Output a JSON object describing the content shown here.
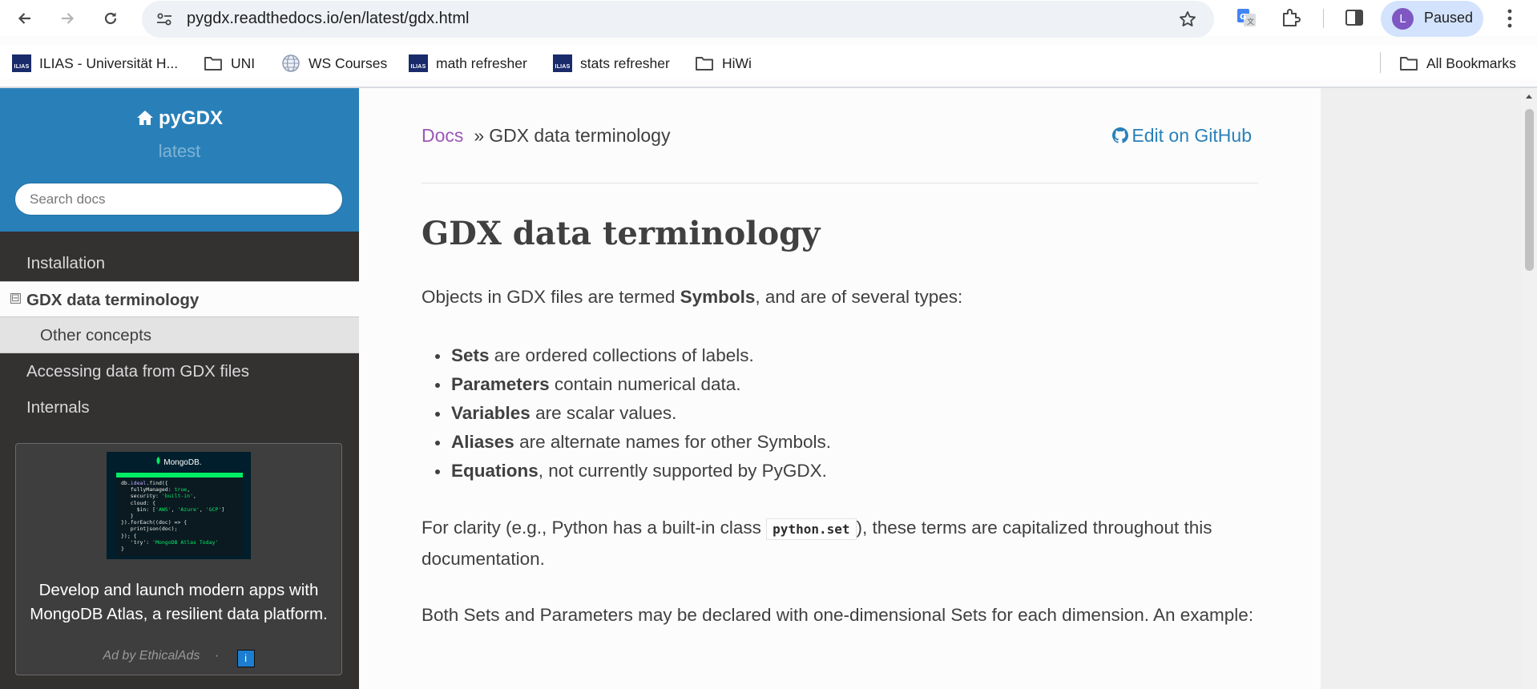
{
  "browser": {
    "url": "pygdx.readthedocs.io/en/latest/gdx.html",
    "profile_initial": "L",
    "profile_status": "Paused",
    "bookmarks": [
      {
        "label": "ILIAS - Universität H...",
        "icon": "ilias-icon"
      },
      {
        "label": "UNI",
        "icon": "folder-icon"
      },
      {
        "label": "WS Courses",
        "icon": "globe-icon"
      },
      {
        "label": "math refresher",
        "icon": "ilias-icon"
      },
      {
        "label": "stats refresher",
        "icon": "ilias-icon"
      },
      {
        "label": "HiWi",
        "icon": "folder-icon"
      }
    ],
    "all_bookmarks": "All Bookmarks"
  },
  "sidebar": {
    "project": "pyGDX",
    "version": "latest",
    "search_placeholder": "Search docs",
    "items": [
      {
        "label": "Installation"
      },
      {
        "label": "GDX data terminology",
        "toggle": "⊟"
      },
      {
        "label": "Other concepts"
      },
      {
        "label": "Accessing data from GDX files"
      },
      {
        "label": "Internals"
      }
    ],
    "ad": {
      "logo": "MongoDB.",
      "text": "Develop and launch modern apps with MongoDB Atlas, a resilient data platform.",
      "by": "Ad by EthicalAds",
      "dot": "·",
      "info": "i"
    }
  },
  "content": {
    "breadcrumb_root": "Docs",
    "breadcrumb_sep": "»",
    "breadcrumb_current": "GDX data terminology",
    "edit_link": "Edit on GitHub",
    "title": "GDX data terminology",
    "intro_pre": "Objects in GDX files are termed ",
    "intro_bold": "Symbols",
    "intro_post": ", and are of several types:",
    "types": [
      {
        "term": "Sets",
        "desc": " are ordered collections of labels."
      },
      {
        "term": "Parameters",
        "desc": " contain numerical data."
      },
      {
        "term": "Variables",
        "desc": " are scalar values."
      },
      {
        "term": "Aliases",
        "desc": " are alternate names for other Symbols."
      },
      {
        "term": "Equations",
        "desc": ", not currently supported by PyGDX."
      }
    ],
    "clarity_pre": "For clarity (e.g., Python has a built-in class ",
    "clarity_code": "python.set",
    "clarity_post": "), these terms are capitalized throughout this documentation.",
    "both": "Both Sets and Parameters may be declared with one-dimensional Sets for each dimension. An example:"
  },
  "colors": {
    "sidebar_top": "#2980b9",
    "sidebar_bg": "#343131",
    "link_visited": "#9b59b6",
    "link": "#2980b9",
    "text": "#404040"
  }
}
